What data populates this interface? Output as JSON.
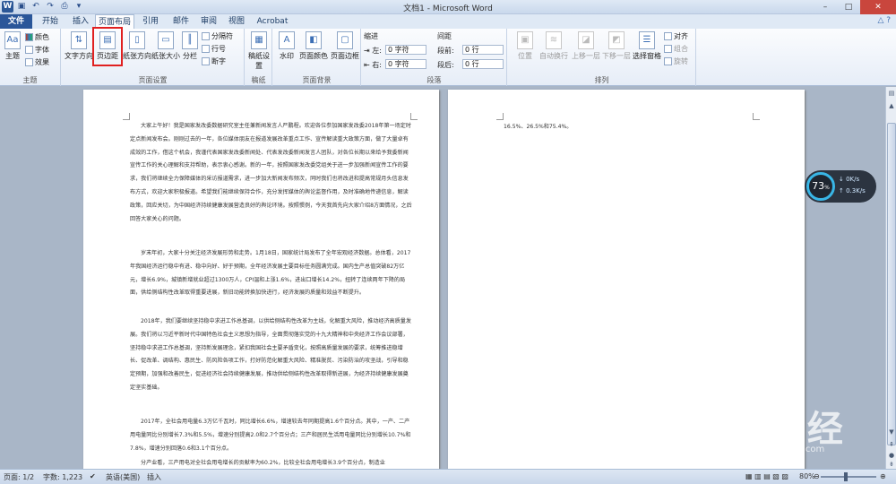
{
  "window": {
    "title": "文档1 - Microsoft Word",
    "app_icon": "W",
    "controls": [
      "–",
      "□",
      "✕"
    ]
  },
  "tabs": [
    {
      "label": "文件"
    },
    {
      "label": "开始"
    },
    {
      "label": "插入"
    },
    {
      "label": "页面布局"
    },
    {
      "label": "引用"
    },
    {
      "label": "邮件"
    },
    {
      "label": "审阅"
    },
    {
      "label": "视图"
    },
    {
      "label": "Acrobat"
    }
  ],
  "ribbon": {
    "theme": {
      "label": "主题",
      "main": "主题",
      "colors": "颜色",
      "fonts": "字体",
      "effects": "效果"
    },
    "page_setup": {
      "label": "页面设置",
      "text_direction": "文字方向",
      "margins": "页边距",
      "orientation": "纸张方向",
      "size": "纸张大小",
      "columns": "分栏",
      "breaks": "分隔符",
      "line_numbers": "行号",
      "hyphenation": "断字"
    },
    "draft": {
      "label": "稿纸",
      "settings": "稿纸设置"
    },
    "background": {
      "label": "页面背景",
      "watermark": "水印",
      "page_color": "页面颜色",
      "page_borders": "页面边框"
    },
    "paragraph": {
      "label": "段落",
      "indent_title": "缩进",
      "spacing_title": "间距",
      "left_label": "左:",
      "left_value": "0 字符",
      "right_label": "右:",
      "right_value": "0 字符",
      "before_label": "段前:",
      "before_value": "0 行",
      "after_label": "段后:",
      "after_value": "0 行"
    },
    "arrange": {
      "label": "排列",
      "position": "位置",
      "wrap_text": "自动换行",
      "bring_forward": "上移一层",
      "send_backward": "下移一层",
      "selection_pane": "选择窗格",
      "align": "对齐",
      "group": "组合",
      "rotate": "旋转"
    }
  },
  "document": {
    "page1_paragraphs": [
      "大家上午好！我是国家发改委数据研究室主任兼新闻发言人严鹏程。欢迎各位参加国家发改委2018年第一场定时定点新闻发布会。刚刚过去的一年，各位媒体朋友在报道发展改革重点工作、宣传解读重大政策方面，做了大量卓有成效的工作，借这个机会，我谨代表国家发改委新闻处、代表发改委新闻发言人团队，对各位长期以来给予我委新闻宣传工作的关心理解和支持帮助，表示衷心感谢。新的一年，按照国家发改委党组关于进一步加强新闻宣传工作的要求，我们将继续全力保障媒体的采访报道需求，进一步加大新闻发布频次，同时我们也将改进和提高常规月头信息发布方式，欢迎大家积极报道。希望我们能继续保持合作，充分发挥媒体的舆论监督作用，及时准确地传递信息，解读政策，回应关切，为中国经济持续健康发展营造良好的舆论环境。按照惯例，今天我首先向大家介绍8方面情况，之后回答大家关心的问题。",
      "岁末年初，大家十分关注经济发展形势和走势。1月18日，国家统计局发布了全年宏观经济数据。总体看，2017年我国经济运行稳中有进、稳中向好、好于预期，全年经济发展主要目标任务圆满完成。国内生产总值突破82万亿元，增长6.9%，城镇新增就业超过1300万人，CPI温和上涨1.6%，进出口增长14.2%，扭转了连续两年下降的局面，供给侧结构性改革取得重要进展，新旧动能转换加快进行，经济发展的质量和效益不断提升。",
      "2018年，我们要继续坚持稳中求进工作总基调，以供给侧结构性改革为主线，化解重大风险，推动经济高质量发展。我们将以习近平新时代中国特色社会主义思想为指导，全面贯彻落实党的十九大精神和中央经济工作会议部署，坚持稳中求进工作总基调，坚持新发展理念，紧扣我国社会主要矛盾变化，按照高质量发展的要求，统筹推进稳增长、促改革、调结构、惠民生、防风险各项工作，打好防范化解重大风险、精准脱贫、污染防治的攻坚战，引导和稳定预期，加强和改善民生，促进经济社会持续健康发展，推动供给侧结构性改革取得新进展，为经济持续健康发展奠定坚实基础。",
      "2017年，全社会用电量6.3万亿千瓦时，同比增长6.6%，增速较去年同期提高1.6个百分点。其中，一产、二产用电量同比分别增长7.3%和5.5%，增速分别提高2.0和2.7个百分点；三产和居民生活用电量同比分别增长10.7%和7.8%，增速分别回落0.6和3.1个百分点。",
      "分产业看，三产用电对全社会用电增长的贡献率为60.2%，比较全社会用电增长3.9个百分点，制造业"
    ],
    "page2_text": "16.5%、26.5%和75.4%。"
  },
  "speed_widget": {
    "percent": "73",
    "percent_unit": "%",
    "down": "0K/s",
    "up": "0.3K/s"
  },
  "watermark": {
    "brand": "Bai du 经验",
    "url": "jingyan.baidu.com"
  },
  "statusbar": {
    "page": "页面: 1/2",
    "words": "字数: 1,223",
    "language": "英语(美国)",
    "mode": "插入",
    "zoom": "80%"
  },
  "colors": {
    "file_tab": "#2a5699",
    "highlight": "#e02020",
    "doc_bg": "#a9b6c7"
  }
}
